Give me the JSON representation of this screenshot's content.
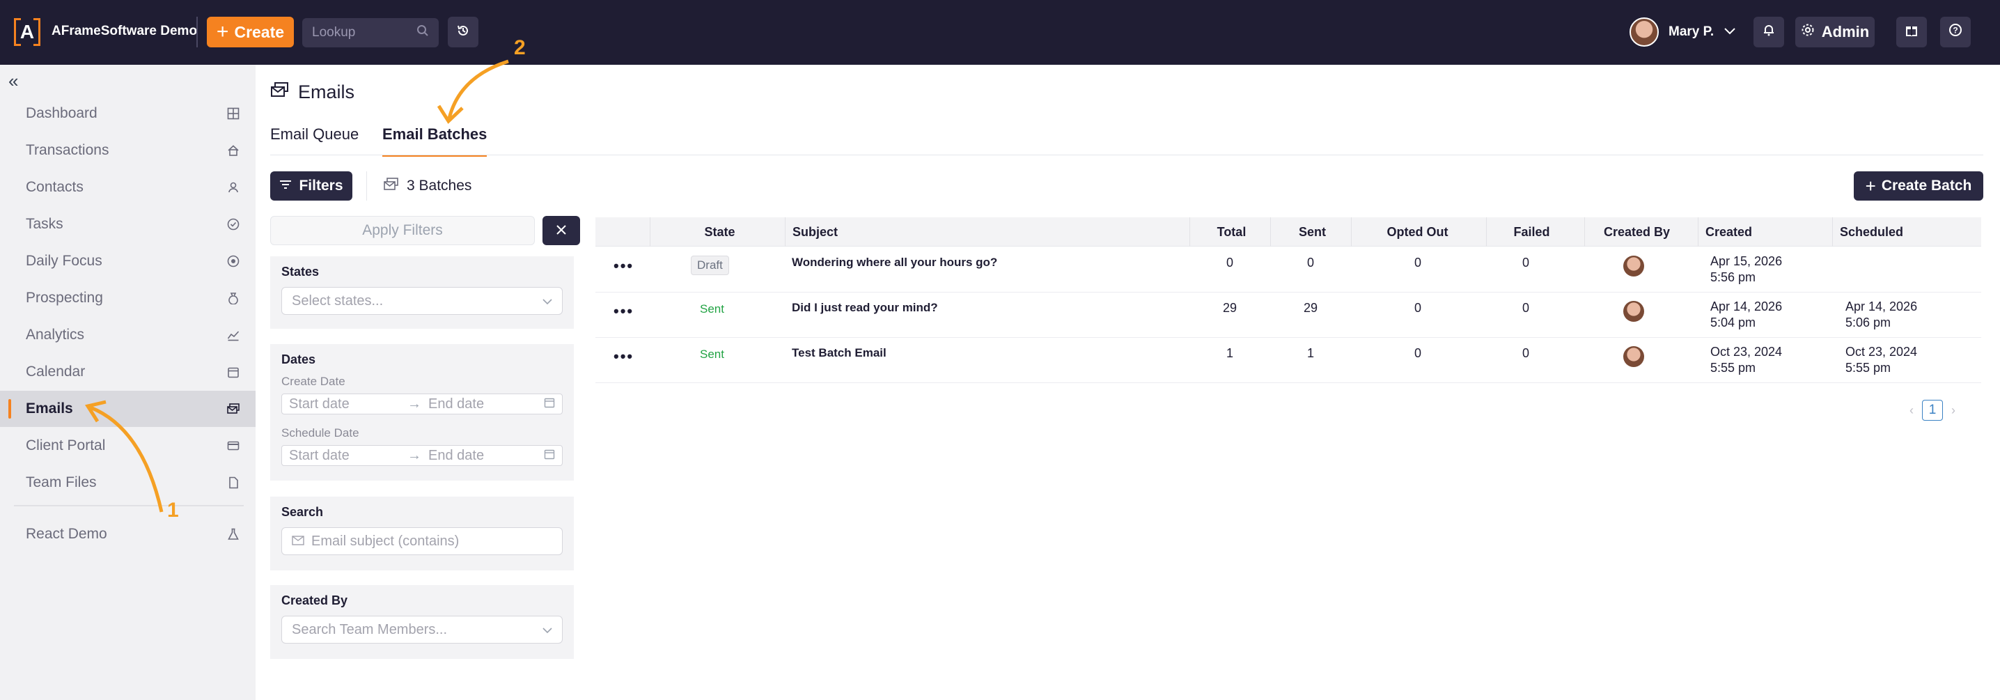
{
  "topbar": {
    "logo_letter": "A",
    "app_title": "AFrameSoftware Demo",
    "create_label": "Create",
    "lookup_placeholder": "Lookup",
    "user_name": "Mary P.",
    "admin_label": "Admin"
  },
  "sidebar": {
    "items": [
      {
        "label": "Dashboard",
        "icon": "grid-icon"
      },
      {
        "label": "Transactions",
        "icon": "house-icon"
      },
      {
        "label": "Contacts",
        "icon": "person-icon"
      },
      {
        "label": "Tasks",
        "icon": "check-circle-icon"
      },
      {
        "label": "Daily Focus",
        "icon": "target-icon"
      },
      {
        "label": "Prospecting",
        "icon": "money-bag-icon"
      },
      {
        "label": "Analytics",
        "icon": "chart-icon"
      },
      {
        "label": "Calendar",
        "icon": "calendar-icon"
      },
      {
        "label": "Emails",
        "icon": "emails-icon",
        "active": true
      },
      {
        "label": "Client Portal",
        "icon": "card-icon"
      },
      {
        "label": "Team Files",
        "icon": "file-icon"
      },
      {
        "label": "React Demo",
        "icon": "flask-icon"
      }
    ]
  },
  "page": {
    "title": "Emails",
    "tabs": [
      "Email Queue",
      "Email Batches"
    ],
    "active_tab": "Email Batches",
    "filters_label": "Filters",
    "batches_count": "3 Batches",
    "create_batch_label": "Create Batch"
  },
  "filters": {
    "apply_label": "Apply Filters",
    "states_label": "States",
    "states_placeholder": "Select states...",
    "dates_label": "Dates",
    "create_date_label": "Create Date",
    "schedule_date_label": "Schedule Date",
    "start_placeholder": "Start date",
    "end_placeholder": "End date",
    "search_label": "Search",
    "search_placeholder": "Email subject (contains)",
    "created_by_label": "Created By",
    "created_by_placeholder": "Search Team Members..."
  },
  "table": {
    "columns": [
      "State",
      "Subject",
      "Total",
      "Sent",
      "Opted Out",
      "Failed",
      "Created By",
      "Created",
      "Scheduled"
    ],
    "rows": [
      {
        "state": "Draft",
        "subject": "Wondering where all your hours go?",
        "total": "0",
        "sent": "0",
        "opted_out": "0",
        "failed": "0",
        "created_date": "Apr 15, 2026",
        "created_time": "5:56 pm",
        "sched_date": "",
        "sched_time": ""
      },
      {
        "state": "Sent",
        "subject": "Did I just read your mind?",
        "total": "29",
        "sent": "29",
        "opted_out": "0",
        "failed": "0",
        "created_date": "Apr 14, 2026",
        "created_time": "5:04 pm",
        "sched_date": "Apr 14, 2026",
        "sched_time": "5:06 pm"
      },
      {
        "state": "Sent",
        "subject": "Test Batch Email",
        "total": "1",
        "sent": "1",
        "opted_out": "0",
        "failed": "0",
        "created_date": "Oct 23, 2024",
        "created_time": "5:55 pm",
        "sched_date": "Oct 23, 2024",
        "sched_time": "5:55 pm"
      }
    ]
  },
  "pagination": {
    "current_page": "1"
  },
  "annotations": {
    "one": "1",
    "two": "2"
  },
  "colors": {
    "accent": "#f58220",
    "topbar": "#1f1d33",
    "sent": "#22a344"
  }
}
